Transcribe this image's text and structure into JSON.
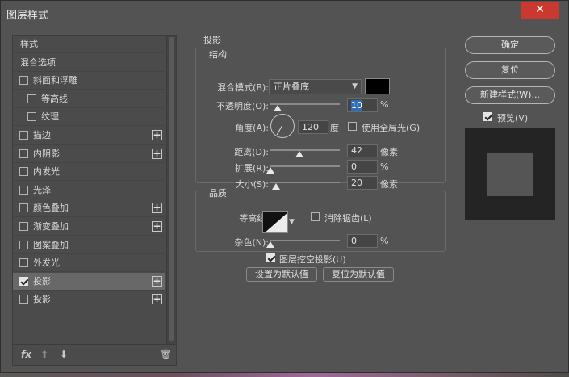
{
  "window": {
    "title": "图层样式",
    "close_glyph": "✕"
  },
  "styles_list": {
    "items": [
      {
        "label": "样式",
        "type": "header"
      },
      {
        "label": "混合选项",
        "type": "header"
      },
      {
        "label": "斜面和浮雕",
        "checked": false,
        "plus": false,
        "indent": 0
      },
      {
        "label": "等高线",
        "checked": false,
        "plus": false,
        "indent": 1
      },
      {
        "label": "纹理",
        "checked": false,
        "plus": false,
        "indent": 1
      },
      {
        "label": "描边",
        "checked": false,
        "plus": true,
        "indent": 0
      },
      {
        "label": "内阴影",
        "checked": false,
        "plus": true,
        "indent": 0
      },
      {
        "label": "内发光",
        "checked": false,
        "plus": false,
        "indent": 0
      },
      {
        "label": "光泽",
        "checked": false,
        "plus": false,
        "indent": 0
      },
      {
        "label": "颜色叠加",
        "checked": false,
        "plus": true,
        "indent": 0
      },
      {
        "label": "渐变叠加",
        "checked": false,
        "plus": true,
        "indent": 0
      },
      {
        "label": "图案叠加",
        "checked": false,
        "plus": false,
        "indent": 0
      },
      {
        "label": "外发光",
        "checked": false,
        "plus": false,
        "indent": 0
      },
      {
        "label": "投影",
        "checked": true,
        "plus": true,
        "indent": 0,
        "selected": true
      },
      {
        "label": "投影",
        "checked": false,
        "plus": true,
        "indent": 0
      }
    ],
    "bottom_icons": {
      "fx": "fx",
      "up": "⬆",
      "down": "⬇",
      "trash": "🗑"
    }
  },
  "drop_shadow": {
    "section_title": "投影",
    "structure": {
      "title": "结构",
      "blend_mode_label": "混合模式(B):",
      "blend_mode_value": "正片叠底",
      "shadow_color": "#000000",
      "opacity_label": "不透明度(O):",
      "opacity_value": "10",
      "opacity_unit": "%",
      "opacity_fraction": 0.1,
      "angle_label": "角度(A):",
      "angle_value": "120",
      "angle_unit": "度",
      "global_light_label": "使用全局光(G)",
      "global_light_checked": false,
      "distance_label": "距离(D):",
      "distance_value": "42",
      "distance_unit": "像素",
      "distance_fraction": 0.42,
      "spread_label": "扩展(R):",
      "spread_value": "0",
      "spread_unit": "%",
      "spread_fraction": 0.0,
      "size_label": "大小(S):",
      "size_value": "20",
      "size_unit": "像素",
      "size_fraction": 0.08
    },
    "quality": {
      "title": "品质",
      "contour_label": "等高线:",
      "antialias_label": "消除锯齿(L)",
      "antialias_checked": false,
      "noise_label": "杂色(N):",
      "noise_value": "0",
      "noise_unit": "%",
      "noise_fraction": 0.0
    },
    "layer_knocks_out_label": "图层挖空投影(U)",
    "layer_knocks_out_checked": true,
    "make_default_label": "设置为默认值",
    "reset_default_label": "复位为默认值"
  },
  "right_panel": {
    "ok_label": "确定",
    "reset_label": "复位",
    "new_style_label": "新建样式(W)...",
    "preview_label": "预览(V)",
    "preview_checked": true
  }
}
